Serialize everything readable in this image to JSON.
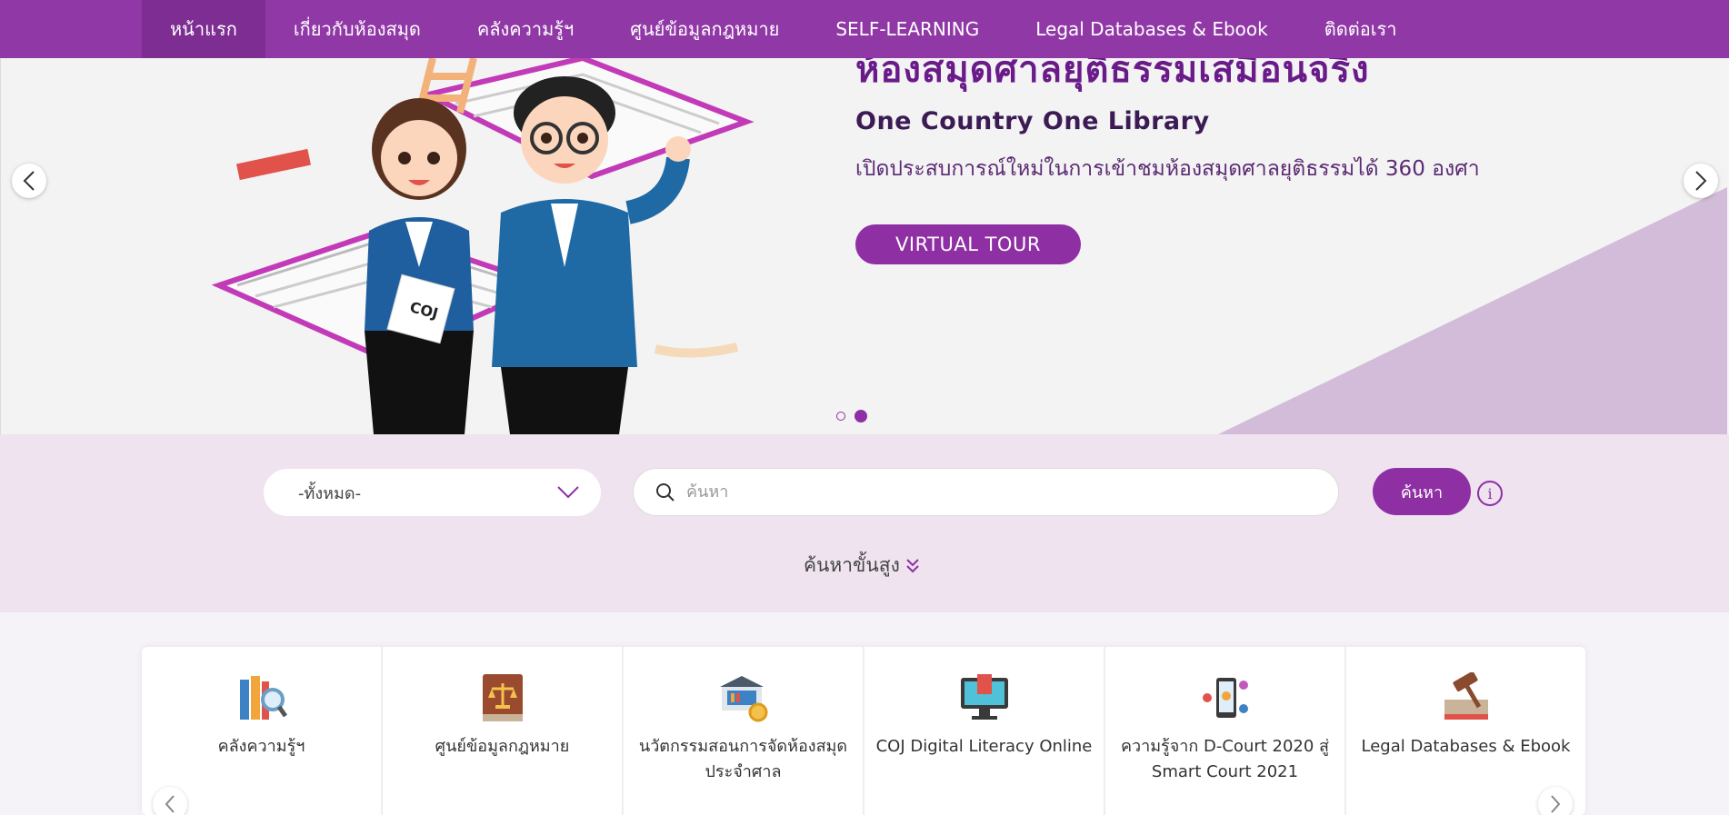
{
  "nav": {
    "items": [
      {
        "label": "หน้าแรก"
      },
      {
        "label": "เกี่ยวกับห้องสมุด"
      },
      {
        "label": "คลังความรู้ฯ"
      },
      {
        "label": "ศูนย์ข้อมูลกฎหมาย"
      },
      {
        "label": "SELF-LEARNING"
      },
      {
        "label": "Legal Databases & Ebook"
      },
      {
        "label": "ติดต่อเรา"
      }
    ]
  },
  "hero": {
    "cut_title": "ห้องสมุดศาลยุติธรรมเสมือนจริง",
    "title": "One Country One Library",
    "subtitle": "เปิดประสบการณ์ใหม่ในการเข้าชมห้องสมุดศาลยุติธรรมได้ 360 องศา",
    "button_label": "VIRTUAL TOUR",
    "badge_text": "COJ",
    "slide_count": 2,
    "active_slide": 2
  },
  "search": {
    "category_value": "-ทั้งหมด-",
    "placeholder": "ค้นหา",
    "button_label": "ค้นหา",
    "advanced_label": "ค้นหาขั้นสูง"
  },
  "categories": [
    {
      "label": "คลังความรู้ฯ",
      "icon": "books-search-icon"
    },
    {
      "label": "ศูนย์ข้อมูลกฎหมาย",
      "icon": "law-book-icon"
    },
    {
      "label": "นวัตกรรมสอนการจัดห้องสมุดประจำศาล",
      "icon": "library-gear-icon"
    },
    {
      "label": "COJ Digital Literacy Online",
      "icon": "monitor-book-icon"
    },
    {
      "label": "ความรู้จาก D-Court 2020 สู่ Smart Court 2021",
      "icon": "smart-phone-icon"
    },
    {
      "label": "Legal Databases & Ebook",
      "icon": "gavel-book-icon"
    }
  ],
  "colors": {
    "primary": "#9138a7",
    "nav_active": "#7e2e93",
    "search_band": "#eee3ee",
    "hero_triangle": "#d3bcd9"
  }
}
